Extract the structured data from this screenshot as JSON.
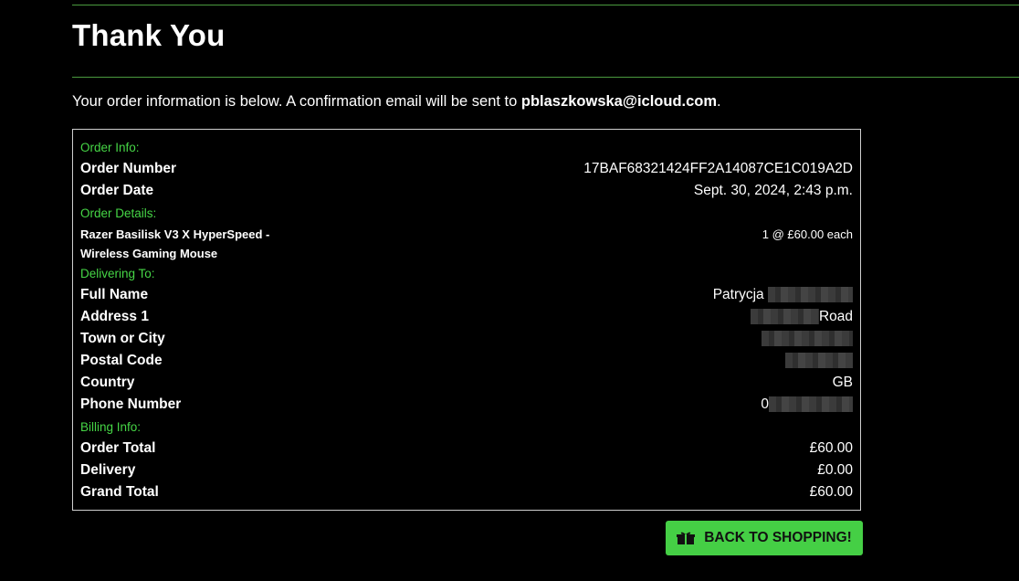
{
  "page": {
    "title": "Thank You",
    "intro_prefix": "Your order information is below. A confirmation email will be sent to ",
    "email": "pblaszkowska@icloud.com",
    "intro_suffix": "."
  },
  "order_info": {
    "section_label": "Order Info:",
    "order_number_label": "Order Number",
    "order_number": "17BAF68321424FF2A14087CE1C019A2D",
    "order_date_label": "Order Date",
    "order_date": "Sept. 30, 2024, 2:43 p.m."
  },
  "order_details": {
    "section_label": "Order Details:",
    "items": [
      {
        "name": "Razer Basilisk V3 X HyperSpeed - Wireless Gaming Mouse",
        "quantity_price": "1 @ £60.00 each"
      }
    ]
  },
  "delivery": {
    "section_label": "Delivering To:",
    "full_name_label": "Full Name",
    "full_name_visible": "Patrycja",
    "address1_label": "Address 1",
    "address1_visible": "Road",
    "town_label": "Town or City",
    "postal_code_label": "Postal Code",
    "country_label": "Country",
    "country": "GB",
    "phone_label": "Phone Number",
    "phone_visible": "0"
  },
  "billing": {
    "section_label": "Billing Info:",
    "order_total_label": "Order Total",
    "order_total": "£60.00",
    "delivery_label": "Delivery",
    "delivery": "£0.00",
    "grand_total_label": "Grand Total",
    "grand_total": "£60.00"
  },
  "actions": {
    "back_to_shopping": "BACK TO SHOPPING!",
    "back_icon": "gift-icon"
  },
  "colors": {
    "background": "#000000",
    "accent_green": "#46d646",
    "button_green": "#45cf45",
    "rule_green": "#4a9a3e"
  }
}
